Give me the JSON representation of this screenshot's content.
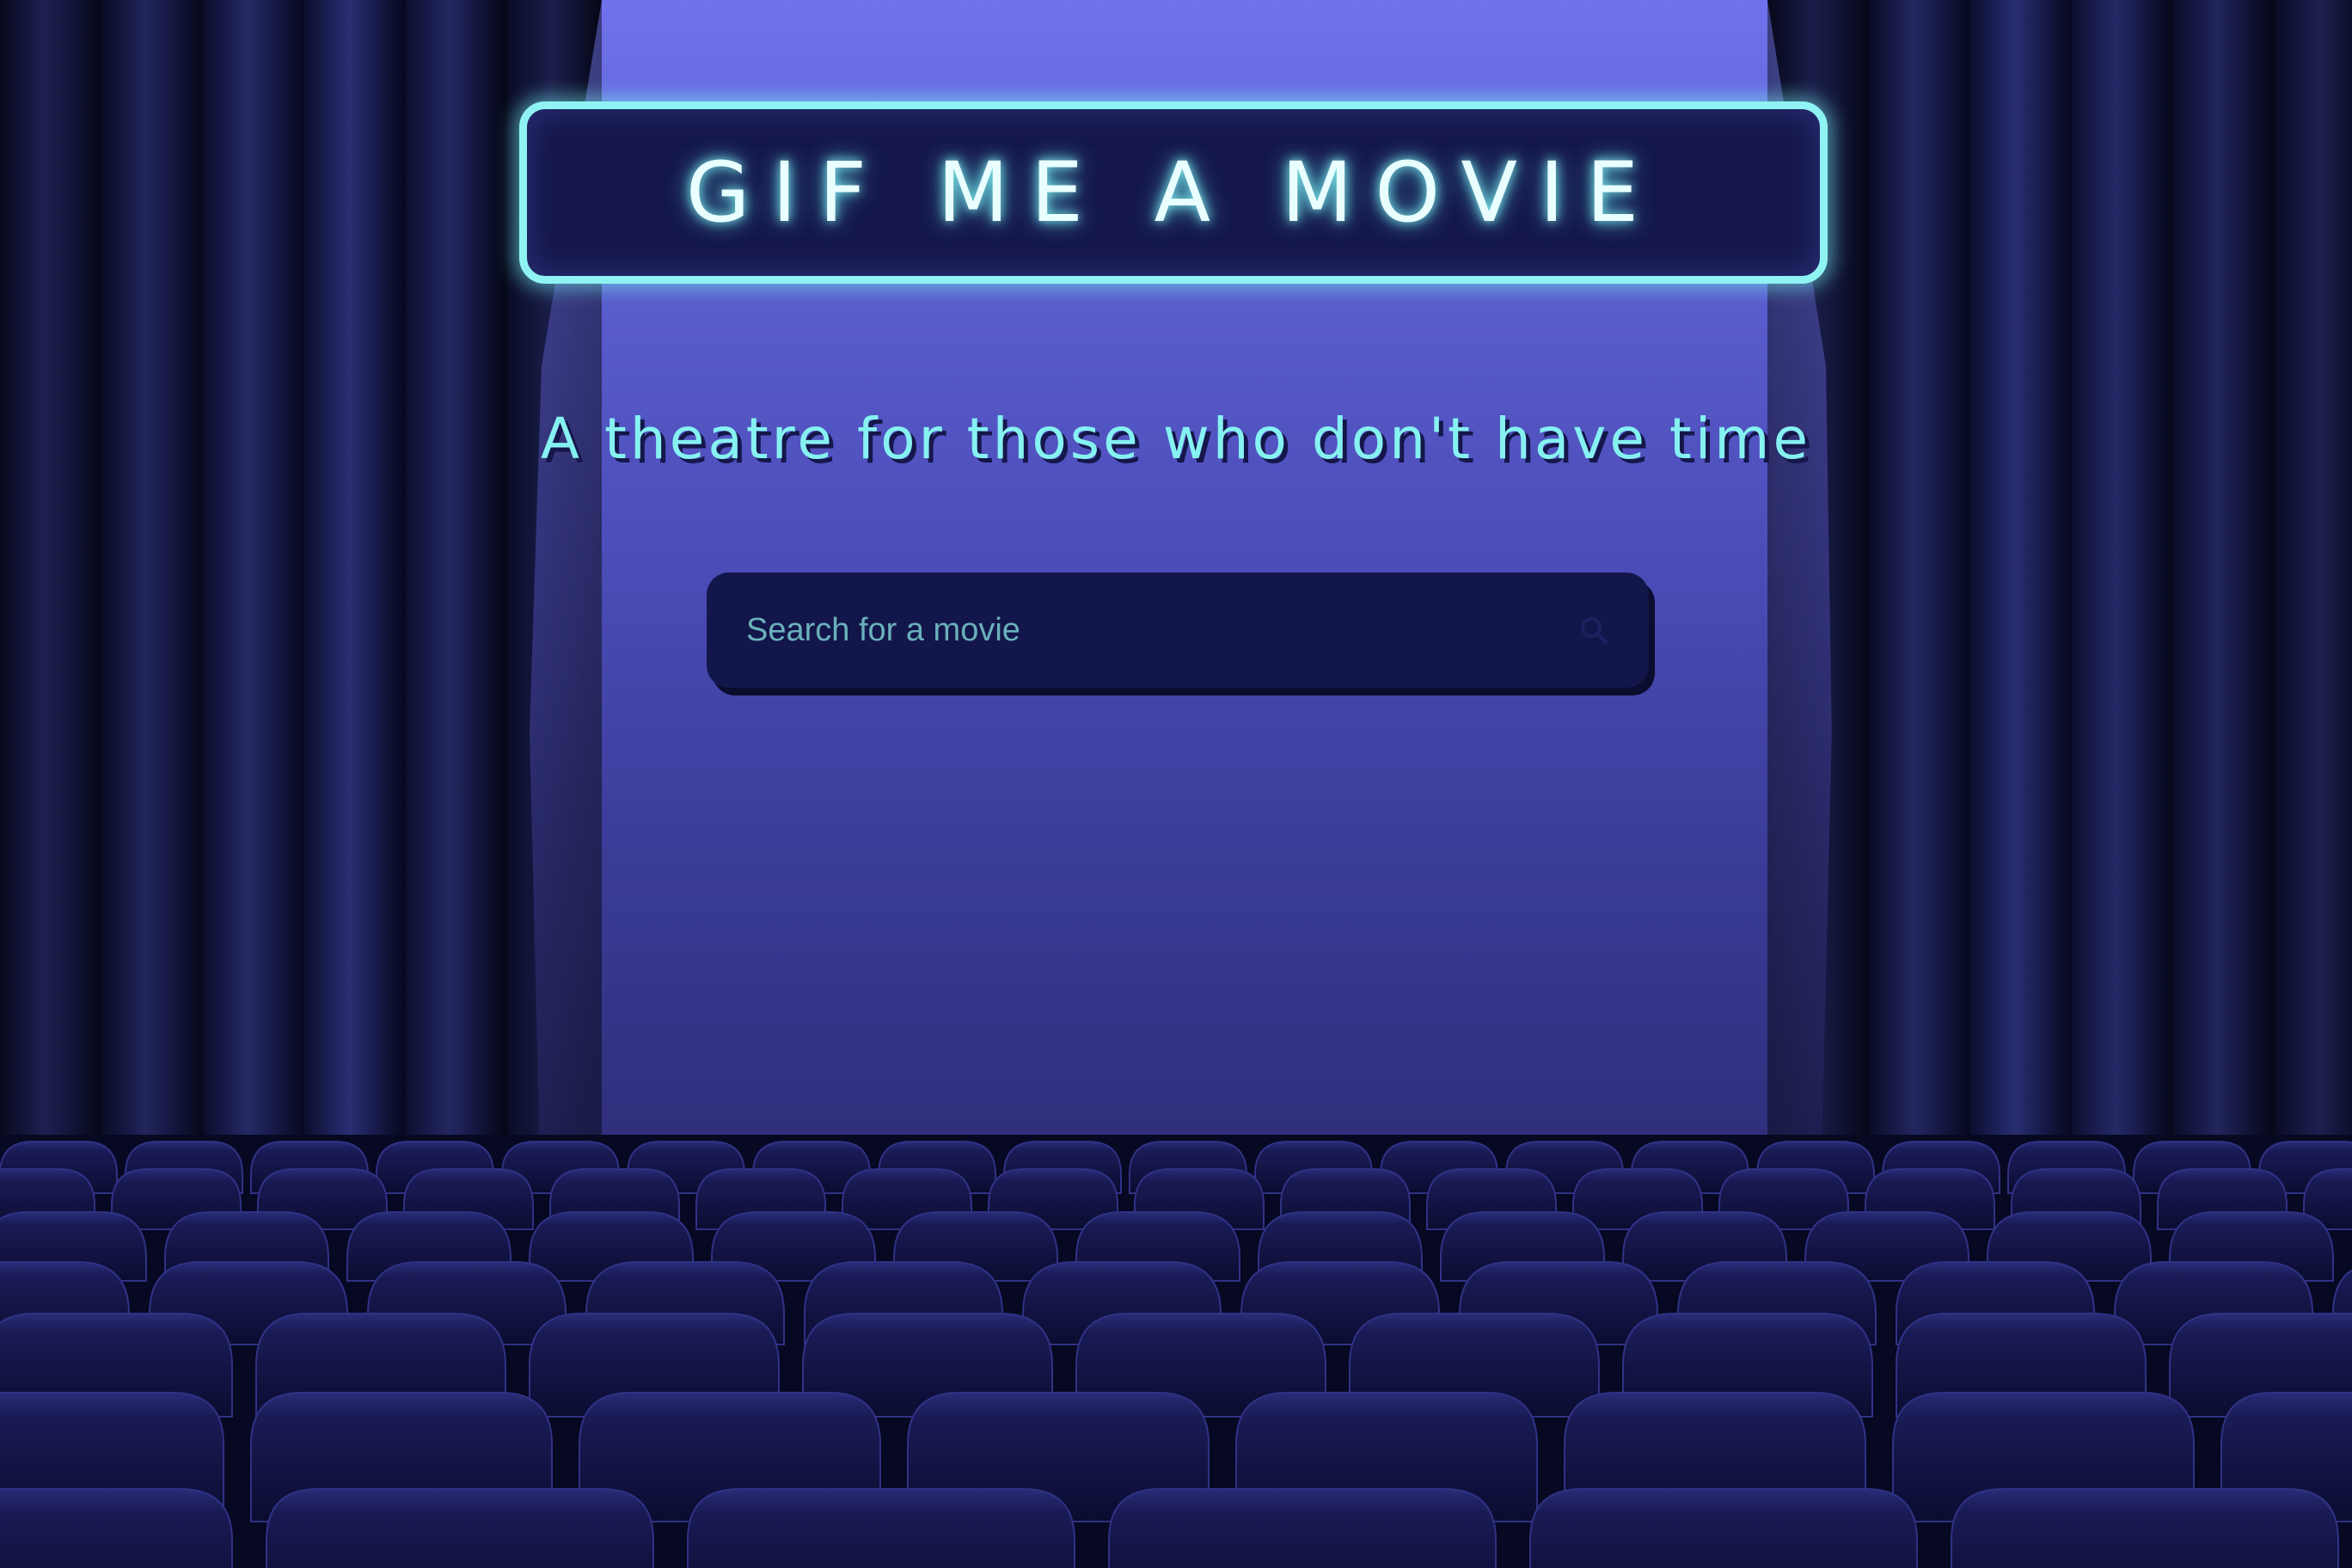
{
  "header": {
    "title": "GIF ME A MOVIE",
    "tagline": "A theatre for those who don't have time"
  },
  "search": {
    "placeholder": "Search for a movie",
    "value": "",
    "icon": "search-icon"
  },
  "theme": {
    "neon_color": "#8ff3f3",
    "panel_color": "#15174a",
    "screen_top_color": "#6f72ec",
    "screen_bottom_color": "#2b2b74",
    "seat_color": "#1a1b52"
  }
}
